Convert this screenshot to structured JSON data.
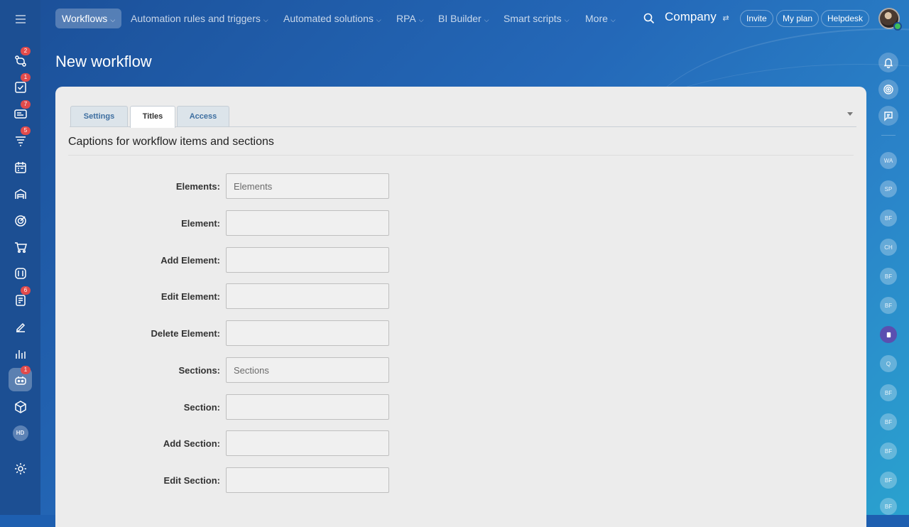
{
  "nav": {
    "items": [
      {
        "label": "Workflows"
      },
      {
        "label": "Automation rules and triggers"
      },
      {
        "label": "Automated solutions"
      },
      {
        "label": "RPA"
      },
      {
        "label": "BI Builder"
      },
      {
        "label": "Smart scripts"
      },
      {
        "label": "More"
      }
    ],
    "company": "Company",
    "invite": "Invite",
    "my_plan": "My plan",
    "helpdesk": "Helpdesk"
  },
  "sidebar": {
    "badges": [
      "2",
      "1",
      "7",
      "5",
      "6",
      "1"
    ],
    "user_initials": "HD"
  },
  "page": {
    "title": "New workflow"
  },
  "tabs": [
    {
      "label": "Settings"
    },
    {
      "label": "Titles"
    },
    {
      "label": "Access"
    }
  ],
  "section": {
    "title": "Captions for workflow items and sections"
  },
  "fields": [
    {
      "label": "Elements:",
      "value": "",
      "placeholder": "Elements"
    },
    {
      "label": "Element:",
      "value": "",
      "placeholder": ""
    },
    {
      "label": "Add Element:",
      "value": "",
      "placeholder": ""
    },
    {
      "label": "Edit Element:",
      "value": "",
      "placeholder": ""
    },
    {
      "label": "Delete Element:",
      "value": "",
      "placeholder": ""
    },
    {
      "label": "Sections:",
      "value": "",
      "placeholder": "Sections"
    },
    {
      "label": "Section:",
      "value": "",
      "placeholder": ""
    },
    {
      "label": "Add Section:",
      "value": "",
      "placeholder": ""
    },
    {
      "label": "Edit Section:",
      "value": "",
      "placeholder": ""
    }
  ],
  "right_rail": {
    "avatars": [
      "WA",
      "SP",
      "BF",
      "CH",
      "BF",
      "BF",
      "",
      "Q",
      "BF",
      "BF",
      "BF",
      "BF",
      "BF"
    ]
  },
  "colors": {
    "accent": "#1c4f93",
    "badge": "#e24b4b",
    "panel": "#ececec"
  }
}
